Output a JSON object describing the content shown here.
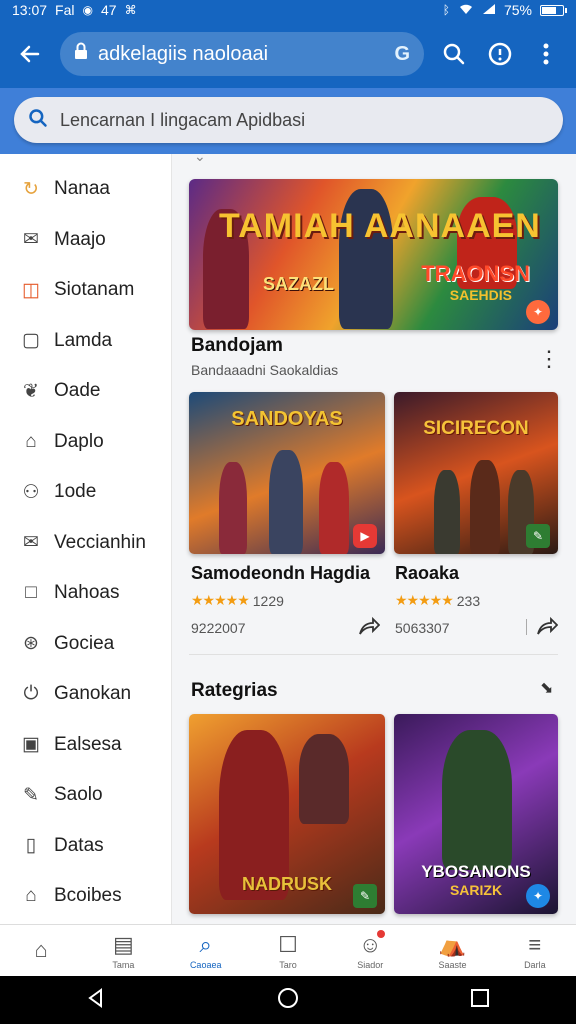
{
  "status_bar": {
    "time": "13:07",
    "carrier": "Fal",
    "extra": "47",
    "battery": "75%",
    "battery_level": 0.75
  },
  "browser": {
    "url": "adkelagiis naoloaai"
  },
  "search": {
    "placeholder": "Lencarnan I lingacam Apidbasi"
  },
  "sidebar": {
    "items": [
      {
        "label": "Nanaa",
        "icon": "refresh-icon"
      },
      {
        "label": "Maajo",
        "icon": "mail-icon"
      },
      {
        "label": "Siotanam",
        "icon": "chart-icon"
      },
      {
        "label": "Lamda",
        "icon": "square-icon"
      },
      {
        "label": "Oade",
        "icon": "leaf-icon"
      },
      {
        "label": "Daplo",
        "icon": "tag-icon"
      },
      {
        "label": "1ode",
        "icon": "people-icon"
      },
      {
        "label": "Veccianhin",
        "icon": "envelope-icon"
      },
      {
        "label": "Nahoas",
        "icon": "box-icon"
      },
      {
        "label": "Gociea",
        "icon": "globe-icon"
      },
      {
        "label": "Ganokan",
        "icon": "power-icon"
      },
      {
        "label": "Ealsesa",
        "icon": "window-icon"
      },
      {
        "label": "Saolo",
        "icon": "pen-icon"
      },
      {
        "label": "Datas",
        "icon": "books-icon"
      },
      {
        "label": "Bcoibes",
        "icon": "tag-icon"
      }
    ]
  },
  "featured": {
    "banner_title": "TAMIAH AANAAEN",
    "banner_sub": "SAZAZL",
    "banner_right": "TRAONSN",
    "banner_right_sub": "SAEHDIS",
    "title": "Bandojam",
    "subtitle": "Bandaaadni Saokaldias"
  },
  "games": [
    {
      "art_title": "SANDOYAS",
      "name": "Samodeondn Hagdia",
      "stars": "★★★★★",
      "rating": "1229",
      "downloads": "9222007"
    },
    {
      "art_title": "SICIRECON",
      "name": "Raoaka",
      "stars": "★★★★★",
      "rating": "233",
      "downloads": "5063307"
    }
  ],
  "categories": {
    "title": "Rategrias",
    "cards": [
      {
        "art_title": "NADRUSK"
      },
      {
        "art_title": "YBOSANONS",
        "art_sub": "SARIZK"
      }
    ]
  },
  "bottom_nav": [
    {
      "label": "",
      "icon": "home-icon"
    },
    {
      "label": "Tama",
      "icon": "image-icon"
    },
    {
      "label": "Caoaea",
      "icon": "search-icon",
      "active": true
    },
    {
      "label": "Taro",
      "icon": "chat-icon"
    },
    {
      "label": "Siador",
      "icon": "face-icon"
    },
    {
      "label": "Saaste",
      "icon": "tent-icon"
    },
    {
      "label": "Darla",
      "icon": "menu-icon"
    }
  ]
}
